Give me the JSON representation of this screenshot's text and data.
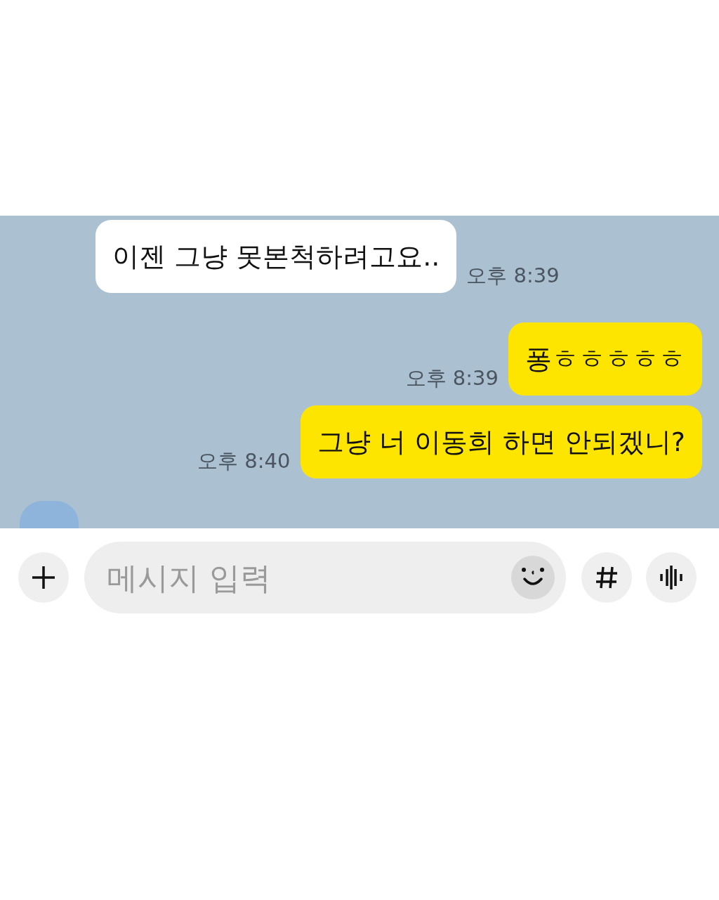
{
  "messages": [
    {
      "kind": "received",
      "text": "이젠 그냥 못본척하려고요..",
      "time": "오후 8:39"
    },
    {
      "kind": "sent",
      "text": "퐁ㅎㅎㅎㅎㅎ",
      "time": "오후 8:39"
    },
    {
      "kind": "sent",
      "text": "그냥 너 이동희 하면 안되겠니?",
      "time": "오후 8:40"
    }
  ],
  "composer": {
    "placeholder": "메시지 입력"
  }
}
